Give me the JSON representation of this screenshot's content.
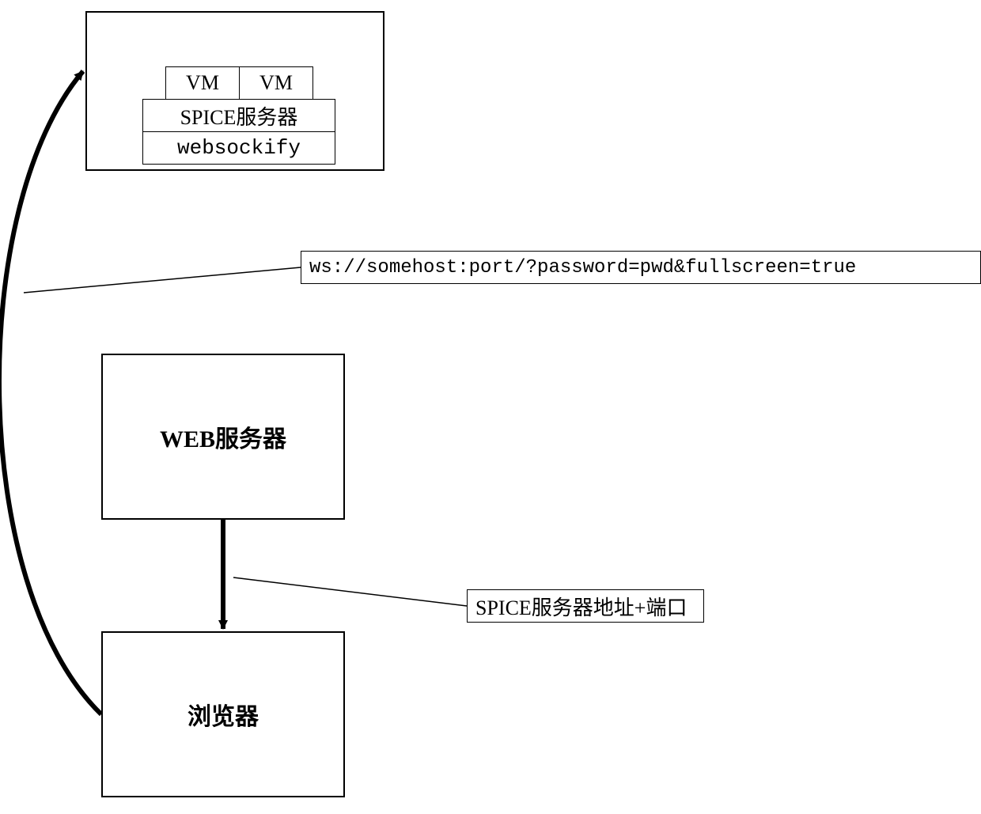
{
  "host_box": {
    "vm1": "VM",
    "vm2": "VM",
    "spice_server": "SPICE服务器",
    "websockify": "websockify"
  },
  "web_server": "WEB服务器",
  "browser": "浏览器",
  "callout_ws": "ws://somehost:port/?password=pwd&fullscreen=true",
  "callout_addr": "SPICE服务器地址+端口"
}
